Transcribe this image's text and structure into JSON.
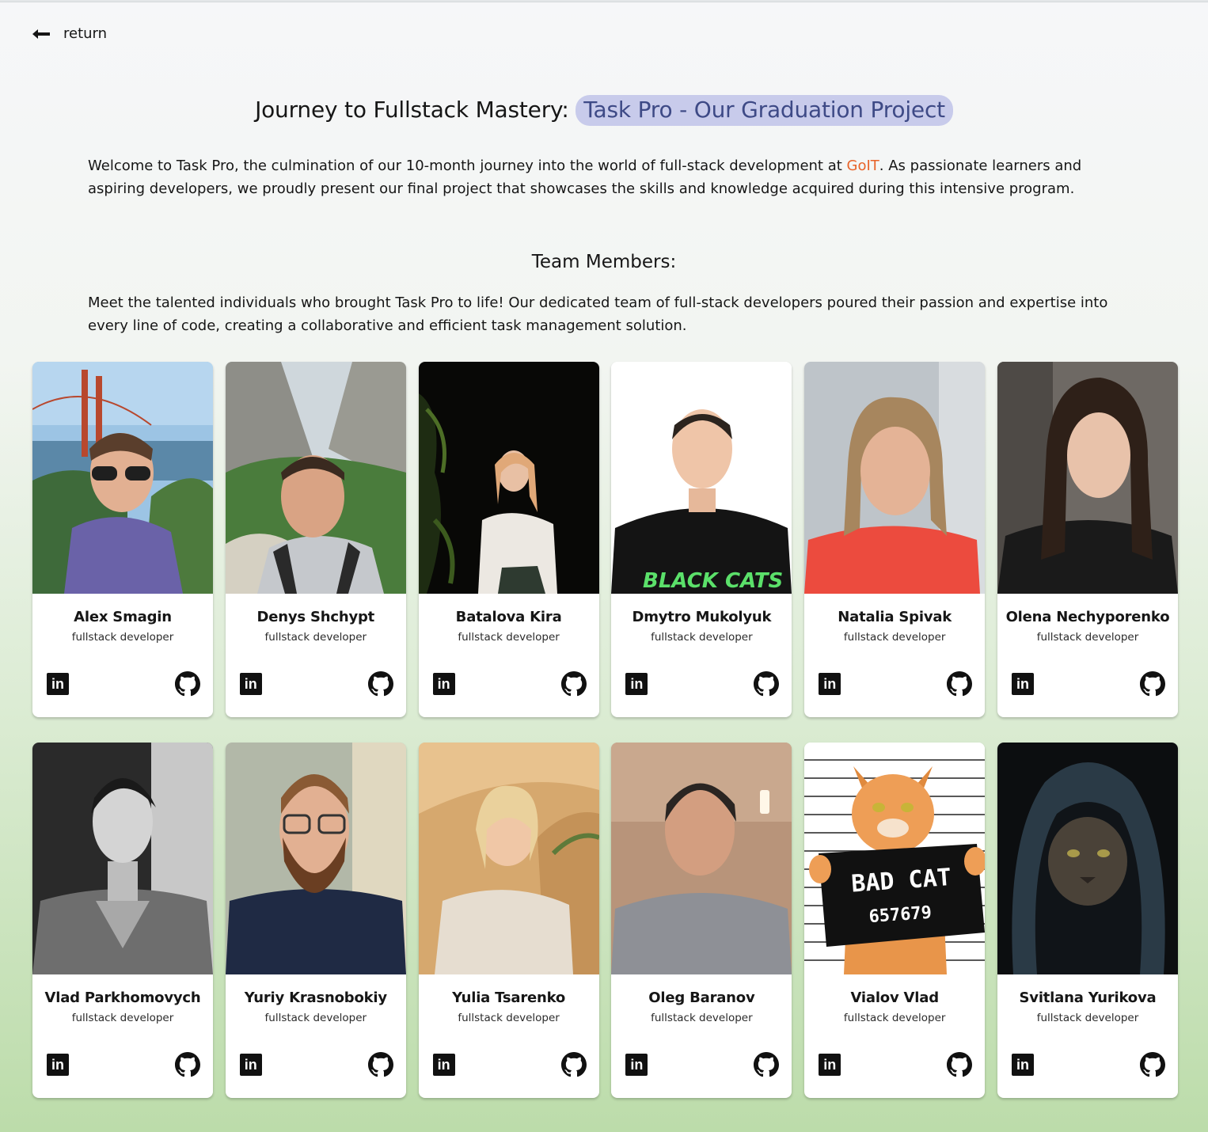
{
  "nav": {
    "return_label": "return"
  },
  "header": {
    "title_prefix": "Journey to Fullstack Mastery:",
    "title_highlight": "Task Pro - Our Graduation Project"
  },
  "intro": {
    "part1": "Welcome to Task Pro, the culmination of our 10-month journey into the world of full-stack development at ",
    "brand": "GoIT",
    "part2": ". As passionate learners and aspiring developers, we proudly present our final project that showcases the skills and knowledge acquired during this intensive program."
  },
  "team": {
    "title": "Team Members:",
    "description": "Meet the talented individuals who brought Task Pro to life! Our dedicated team of full-stack developers poured their passion and expertise into every line of code, creating a collaborative and efficient task management solution.",
    "members": [
      {
        "name": "Alex Smagin",
        "role": "fullstack developer"
      },
      {
        "name": "Denys Shchypt",
        "role": "fullstack developer"
      },
      {
        "name": "Batalova Kira",
        "role": "fullstack developer"
      },
      {
        "name": "Dmytro Mukolyuk",
        "role": "fullstack developer"
      },
      {
        "name": "Natalia Spivak",
        "role": "fullstack developer"
      },
      {
        "name": "Olena Nechyporenko",
        "role": "fullstack developer"
      },
      {
        "name": "Vlad Parkhomovych",
        "role": "fullstack developer"
      },
      {
        "name": "Yuriy Krasnobokiy",
        "role": "fullstack developer"
      },
      {
        "name": "Yulia Tsarenko",
        "role": "fullstack developer"
      },
      {
        "name": "Oleg Baranov",
        "role": "fullstack developer"
      },
      {
        "name": "Vialov Vlad",
        "role": "fullstack developer"
      },
      {
        "name": "Svitlana Yurikova",
        "role": "fullstack developer"
      }
    ],
    "linkedin_icon_text": "in",
    "bad_cat": {
      "line1": "BAD CAT",
      "line2": "657679"
    }
  },
  "colors": {
    "accent_highlight_bg": "#c8cbeb",
    "accent_highlight_text": "#3e4a86",
    "brand_orange": "#e8642a"
  },
  "icons": {
    "return": "arrow-left-icon",
    "linkedin": "linkedin-icon",
    "github": "github-icon"
  }
}
